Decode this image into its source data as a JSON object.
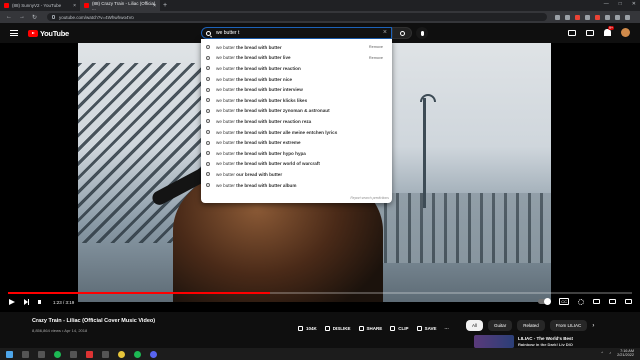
{
  "browser": {
    "tabs": [
      {
        "title": "(88) SunnyV2 - YouTube",
        "active": false
      },
      {
        "title": "(88) Crazy Train - Liliac (Official ...",
        "active": true
      }
    ],
    "new_tab": "+",
    "url": "youtube.com/watch?v=4Whwhwo4Vo"
  },
  "masthead": {
    "logo_text": "YouTube",
    "search_value": "we butter t",
    "notification_count": "9+"
  },
  "suggestions": [
    {
      "typed": "we butter",
      "rest": " the bread with butter",
      "history": true,
      "remove": "Remove"
    },
    {
      "typed": "we butter",
      "rest": " the bread with butter live",
      "history": true,
      "remove": "Remove"
    },
    {
      "typed": "we butter",
      "rest": " the bread with butter reaction",
      "history": false
    },
    {
      "typed": "we butter",
      "rest": " the bread with butter nice",
      "history": false
    },
    {
      "typed": "we butter",
      "rest": " the bread with butter interview",
      "history": false
    },
    {
      "typed": "we butter",
      "rest": " the bread with butter klicks likes",
      "history": false
    },
    {
      "typed": "we butter",
      "rest": " the bread with butter zynoman & astronaut",
      "history": false
    },
    {
      "typed": "we butter",
      "rest": " the bread with butter reaction reza",
      "history": false
    },
    {
      "typed": "we butter",
      "rest": " the bread with butter alle meine entchen lyrics",
      "history": false
    },
    {
      "typed": "we butter",
      "rest": " the bread with butter extreme",
      "history": false
    },
    {
      "typed": "we butter",
      "rest": " the bread with butter hypo hypa",
      "history": false
    },
    {
      "typed": "we butter",
      "rest": " the bread with butter world of warcraft",
      "history": false
    },
    {
      "typed": "we butter",
      "rest": " our bread with butter",
      "history": false
    },
    {
      "typed": "we butter",
      "rest": " the bread with butter album",
      "history": false
    }
  ],
  "report_text": "Report search predictions",
  "player": {
    "time": "1:23 / 3:19",
    "progress_fraction": 0.42
  },
  "video": {
    "title": "Crazy Train - Liliac (Official Cover Music Video)",
    "meta": "8,856,864 views • Apr 14, 2018",
    "actions": {
      "like": "104K",
      "dislike": "DISLIKE",
      "share": "SHARE",
      "clip": "CLIP",
      "save": "SAVE"
    }
  },
  "chips": [
    "All",
    "Guitar",
    "Related",
    "From LILIAC"
  ],
  "chip_next": "›",
  "related": {
    "title": "LILIAC - The World's Best",
    "subtitle": "Rainbow in the Dark! Liv DIO"
  },
  "taskbar": {
    "time": "7:16 AM",
    "date": "2/21/2022"
  }
}
